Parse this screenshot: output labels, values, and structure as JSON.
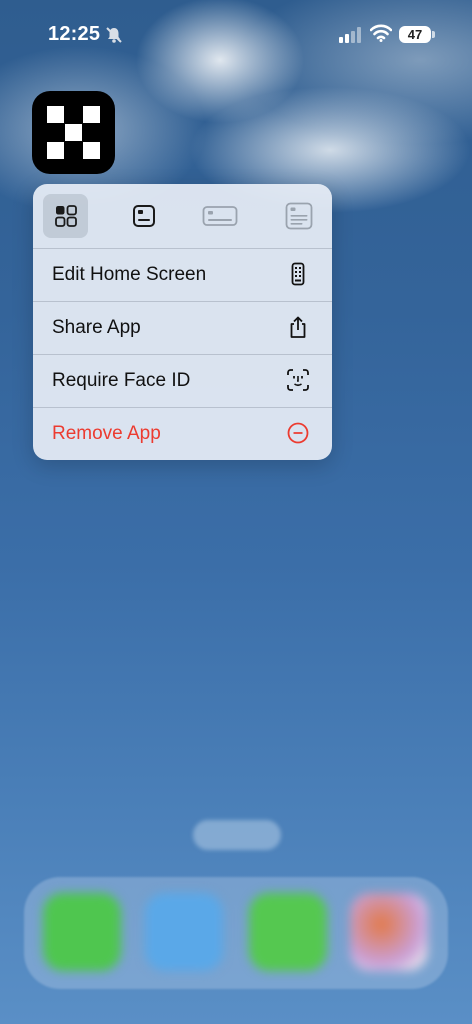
{
  "status_bar": {
    "time": "12:25",
    "battery": "47",
    "icons": [
      "bell-slash-icon",
      "signal-icon",
      "wifi-icon",
      "battery-icon"
    ]
  },
  "app": {
    "icon": "checkerboard-app-icon"
  },
  "menu": {
    "widget_sizes": [
      {
        "icon": "small-grid-widget-icon",
        "selected": true
      },
      {
        "icon": "small-widget-icon",
        "selected": false
      },
      {
        "icon": "medium-widget-icon",
        "selected": false
      },
      {
        "icon": "large-widget-icon",
        "selected": false
      }
    ],
    "items": [
      {
        "label": "Edit Home Screen",
        "icon": "phone-icon"
      },
      {
        "label": "Share App",
        "icon": "share-icon"
      },
      {
        "label": "Require Face ID",
        "icon": "face-id-icon"
      },
      {
        "label": "Remove App",
        "icon": "minus-circle-icon",
        "destructive": true
      }
    ]
  },
  "colors": {
    "destructive": "#ec3b30",
    "menu_background": "#e8eef6",
    "wallpaper_top": "#2f5d8f",
    "wallpaper_bottom": "#5a8fc6"
  },
  "dock": {
    "apps": [
      "phone-app",
      "safari-app",
      "messages-app",
      "photos-app"
    ]
  }
}
